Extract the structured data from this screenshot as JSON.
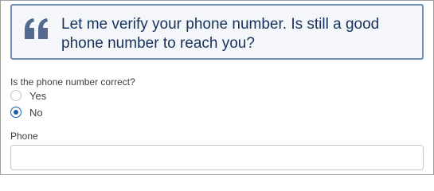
{
  "script_prompt": {
    "icon": "quote-icon",
    "text": "Let me verify your phone number. Is still a good phone number to reach you?"
  },
  "question": {
    "label": "Is the phone number correct?",
    "options": [
      {
        "label": "Yes",
        "selected": false
      },
      {
        "label": "No",
        "selected": true
      }
    ]
  },
  "phone": {
    "label": "Phone",
    "value": "",
    "placeholder": ""
  },
  "colors": {
    "prompt_border": "#6f8fb5",
    "prompt_background": "#f4f6f9",
    "prompt_text": "#16325c",
    "radio_selected": "#1b5fb1"
  }
}
